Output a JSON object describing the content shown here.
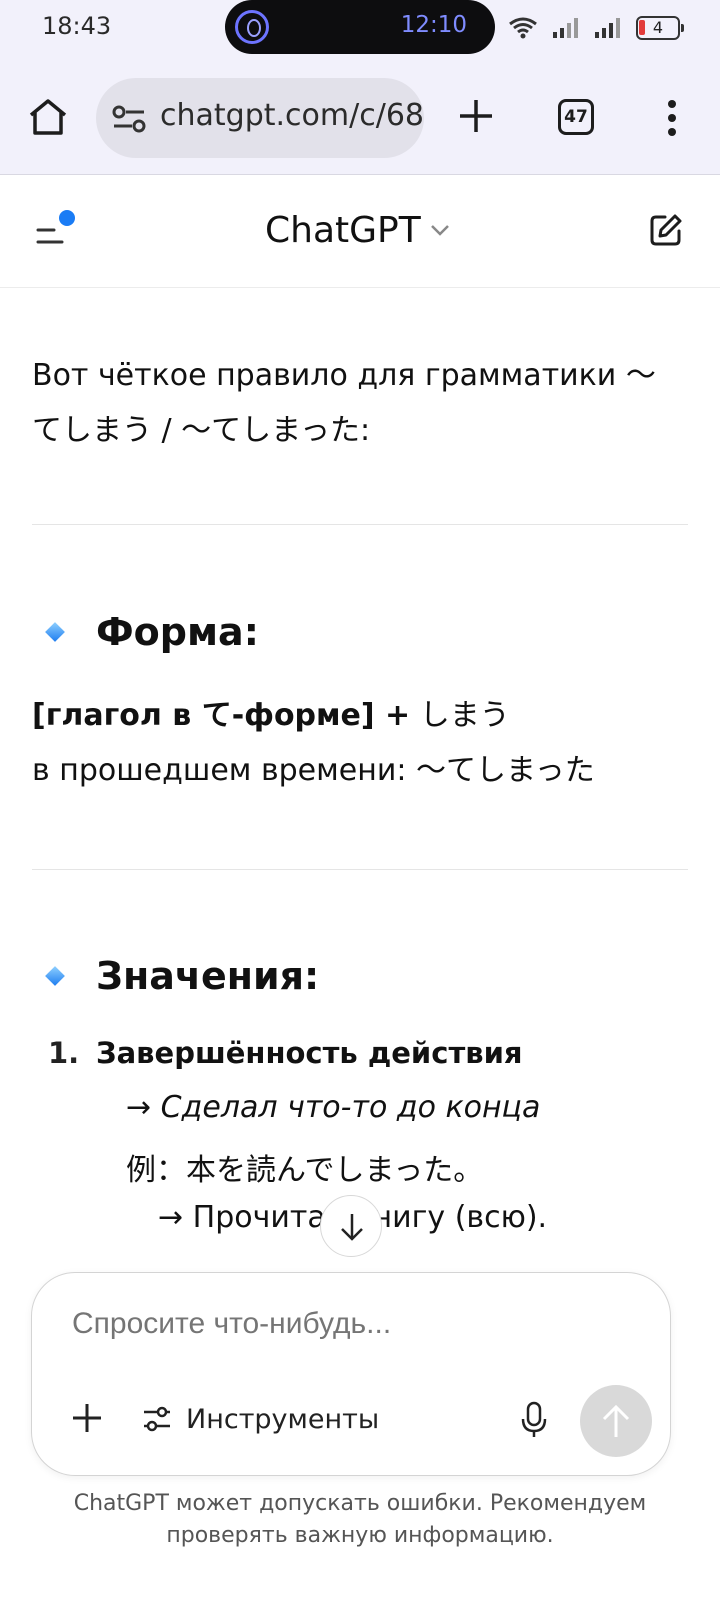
{
  "status_bar": {
    "time": "18:43",
    "island_time": "12:10",
    "battery": "4"
  },
  "browser": {
    "url": "chatgpt.com/c/68",
    "tab_count": "47",
    "icons": [
      "home-icon",
      "site-settings-icon",
      "plus-icon",
      "tab-switcher-icon",
      "more-vert-icon"
    ]
  },
  "chat_header": {
    "title": "ChatGPT",
    "accent_dot_color": "#1a7cf5"
  },
  "message": {
    "intro": "Вот чёткое правило для грамматики 〜てしまう / 〜てしまった:",
    "section_form": {
      "heading": "Форма:",
      "line1_bold": "[глагол в て-форме] +",
      "line1_rest": " しまう",
      "line2": "в прошедшем времени: 〜てしまった"
    },
    "section_meanings": {
      "heading": "Значения:",
      "items": [
        {
          "number": "1.",
          "title": "Завершённость действия",
          "gloss": "→ Сделал что-то до конца",
          "example": "例：本を読んでしまった。",
          "translation": "→ Прочитал книгу (всю)."
        }
      ]
    }
  },
  "composer": {
    "placeholder": "Спросите что-нибудь...",
    "tools_label": "Инструменты"
  },
  "disclaimer": "ChatGPT может допускать ошибки. Рекомендуем проверять важную информацию."
}
